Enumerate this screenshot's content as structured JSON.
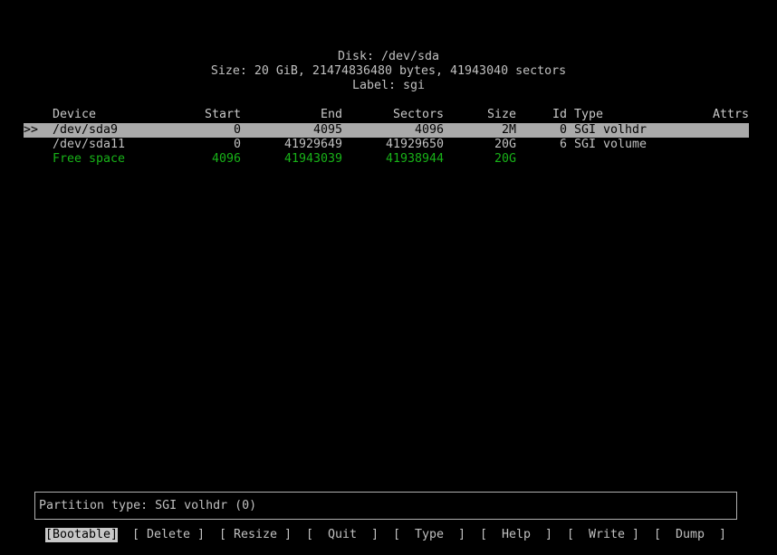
{
  "disk": {
    "title": "Disk: /dev/sda",
    "size_line": "Size: 20 GiB, 21474836480 bytes, 41943040 sectors",
    "label_line": "Label: sgi"
  },
  "table": {
    "headers": {
      "device": "Device",
      "start": "Start",
      "end": "End",
      "sectors": "Sectors",
      "size": "Size",
      "id": "Id",
      "type": "Type",
      "attrs": "Attrs"
    },
    "cursor": ">>",
    "rows": [
      {
        "device": "/dev/sda9",
        "start": "0",
        "end": "4095",
        "sectors": "4096",
        "size": "2M",
        "id": "0",
        "type": "SGI volhdr",
        "attrs": ""
      },
      {
        "device": "/dev/sda11",
        "start": "0",
        "end": "41929649",
        "sectors": "41929650",
        "size": "20G",
        "id": "6",
        "type": "SGI volume",
        "attrs": ""
      },
      {
        "device": "Free space",
        "start": "4096",
        "end": "41943039",
        "sectors": "41938944",
        "size": "20G",
        "id": "",
        "type": "",
        "attrs": ""
      }
    ]
  },
  "info": {
    "text": "Partition type: SGI volhdr (0)"
  },
  "menu": {
    "bootable": "[Bootable]",
    "delete": "[ Delete ]",
    "resize": "[ Resize ]",
    "quit": "[  Quit  ]",
    "type": "[  Type  ]",
    "help": "[  Help  ]",
    "write": "[  Write ]",
    "dump": "[  Dump  ]"
  },
  "colors": {
    "background": "#000000",
    "text": "#c0c0c0",
    "selection": "#aaaaaa",
    "free_space": "#18b218"
  }
}
